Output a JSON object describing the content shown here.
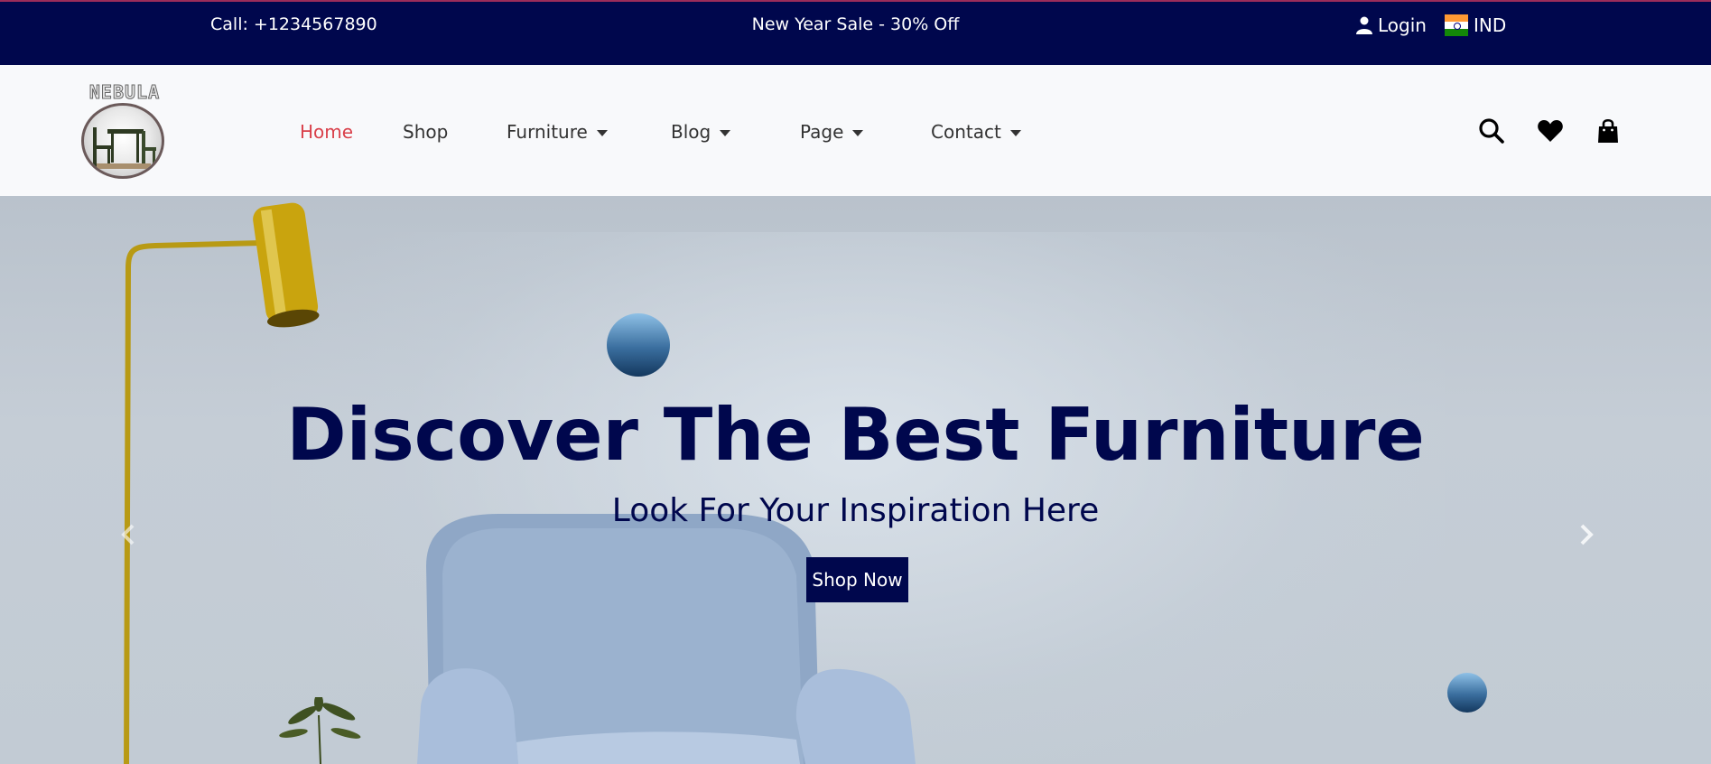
{
  "topbar": {
    "call": "Call: +1234567890",
    "sale": "New Year Sale - 30% Off",
    "login": "Login",
    "country": "IND"
  },
  "logo": {
    "text": "NEBULA"
  },
  "nav": {
    "items": [
      {
        "label": "Home",
        "active": true,
        "dropdown": false
      },
      {
        "label": "Shop",
        "active": false,
        "dropdown": false
      },
      {
        "label": "Furniture",
        "active": false,
        "dropdown": true
      },
      {
        "label": "Blog",
        "active": false,
        "dropdown": true
      },
      {
        "label": "Page",
        "active": false,
        "dropdown": true
      },
      {
        "label": "Contact",
        "active": false,
        "dropdown": true
      }
    ],
    "icons": [
      "search-icon",
      "heart-icon",
      "shopping-bag-icon"
    ]
  },
  "hero": {
    "title": "Discover The Best Furniture",
    "subtitle": "Look For Your Inspiration Here",
    "cta": "Shop Now"
  },
  "colors": {
    "brand_navy": "#00074d",
    "active_link": "#d9404a",
    "navbar_bg": "#f8f9fb"
  }
}
